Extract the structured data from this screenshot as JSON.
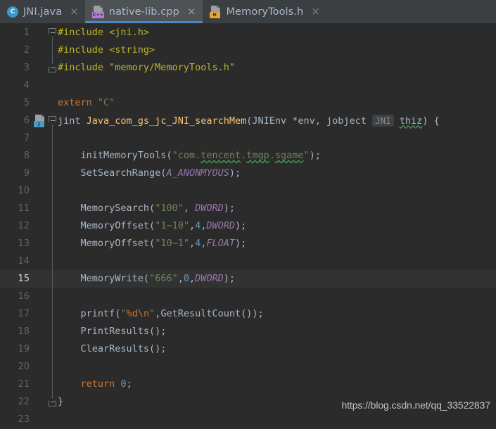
{
  "tabs": [
    {
      "label": "JNI.java",
      "icon": "java-class-icon",
      "badge": "C",
      "active": false,
      "close": "×"
    },
    {
      "label": "native-lib.cpp",
      "icon": "cpp-file-icon",
      "badge": "C++",
      "active": true,
      "close": "×"
    },
    {
      "label": "MemoryTools.h",
      "icon": "header-file-icon",
      "badge": "H",
      "active": false,
      "close": "×"
    }
  ],
  "editor": {
    "current_line": 15,
    "gutter_icon_line": 6,
    "gutter_icon_badge": "J",
    "lines": [
      {
        "n": "1",
        "fold": "down"
      },
      {
        "n": "2",
        "fold": "line"
      },
      {
        "n": "3",
        "fold": "up"
      },
      {
        "n": "4",
        "fold": "none"
      },
      {
        "n": "5",
        "fold": "none"
      },
      {
        "n": "6",
        "fold": "down"
      },
      {
        "n": "7",
        "fold": "line"
      },
      {
        "n": "8",
        "fold": "line"
      },
      {
        "n": "9",
        "fold": "line"
      },
      {
        "n": "10",
        "fold": "line"
      },
      {
        "n": "11",
        "fold": "line"
      },
      {
        "n": "12",
        "fold": "line"
      },
      {
        "n": "13",
        "fold": "line"
      },
      {
        "n": "14",
        "fold": "line"
      },
      {
        "n": "15",
        "fold": "line"
      },
      {
        "n": "16",
        "fold": "line"
      },
      {
        "n": "17",
        "fold": "line"
      },
      {
        "n": "18",
        "fold": "line"
      },
      {
        "n": "19",
        "fold": "line"
      },
      {
        "n": "20",
        "fold": "line"
      },
      {
        "n": "21",
        "fold": "line"
      },
      {
        "n": "22",
        "fold": "up"
      },
      {
        "n": "23",
        "fold": "none"
      }
    ],
    "code": {
      "l1": "#include <jni.h>",
      "l2": "#include <string>",
      "l3": "#include \"memory/MemoryTools.h\"",
      "l5_kw": "extern",
      "l5_str": "\"C\"",
      "l6_ret": "jint",
      "l6_name": "Java_com_gs_jc_JNI_searchMem",
      "l6_p1": "JNIEnv *env, jobject",
      "l6_hint": "JNI",
      "l6_arg": "thiz",
      "l6_tail": ") {",
      "l8_fn": "initMemoryTools(",
      "l8_q1": "\"com.",
      "l8_s1": "tencent",
      "l8_d1": ".",
      "l8_s2": "tmgp",
      "l8_d2": ".",
      "l8_s3": "sgame",
      "l8_q2": "\"",
      "l8_end": ");",
      "l9_fn": "SetSearchRange(",
      "l9_const": "A_ANONMYOUS",
      "l9_end": ");",
      "l11_fn": "MemorySearch(",
      "l11_str": "\"100\"",
      "l11_sep": ", ",
      "l11_const": "DWORD",
      "l11_end": ");",
      "l12_fn": "MemoryOffset(",
      "l12_str": "\"1~10\"",
      "l12_sep": ",",
      "l12_num": "4",
      "l12_const": "DWORD",
      "l12_end": ");",
      "l13_fn": "MemoryOffset(",
      "l13_str": "\"10~1\"",
      "l13_sep": ",",
      "l13_num": "4",
      "l13_const": "FLOAT",
      "l13_end": ");",
      "l15_fn": "MemoryWrite(",
      "l15_str": "\"666\"",
      "l15_sep": ",",
      "l15_num": "0",
      "l15_const": "DWORD",
      "l15_end": ");",
      "l17_fn": "printf(",
      "l17_q1": "\"",
      "l17_fmt": "%d\\n",
      "l17_q2": "\"",
      "l17_sep": ",",
      "l17_call": "GetResultCount()",
      "l17_end": ");",
      "l18": "PrintResults();",
      "l19": "ClearResults();",
      "l21_kw": "return",
      "l21_num": "0",
      "l21_end": ";",
      "l22": "}"
    }
  },
  "watermark": "https://blog.csdn.net/qq_33522837",
  "colors": {
    "editor_bg": "#2b2b2b",
    "current_line_bg": "#323232",
    "tabbar_bg": "#3c3f41",
    "active_tab_bg": "#4e5254",
    "active_tab_underline": "#4a88c7",
    "keyword": "#cc7832",
    "string": "#6a8759",
    "number": "#6897bb",
    "function": "#ffc66d",
    "constant": "#9876aa",
    "preprocessor": "#bbb529",
    "text": "#a9b7c6",
    "line_number": "#606366",
    "squiggle": "#499c54"
  }
}
